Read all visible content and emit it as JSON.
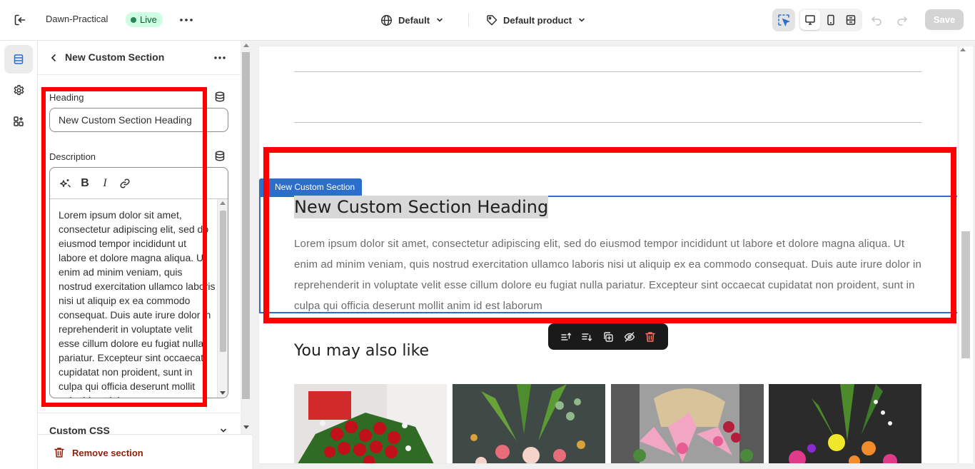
{
  "topbar": {
    "store_name": "Dawn-Practical",
    "status": "Live",
    "theme_select": "Default",
    "template_select": "Default product",
    "save_label": "Save"
  },
  "panel": {
    "title": "New Custom Section",
    "heading_label": "Heading",
    "heading_value": "New Custom Section Heading",
    "description_label": "Description",
    "description_text": "Lorem ipsum dolor sit amet, consectetur adipiscing elit, sed do eiusmod tempor incididunt ut labore et dolore magna aliqua. Ut enim ad minim veniam, quis nostrud exercitation ullamco laboris nisi ut aliquip ex ea commodo consequat. Duis aute irure dolor in reprehenderit in voluptate velit esse cillum dolore eu fugiat nulla pariatur. Excepteur sint occaecat cupidatat non proident, sunt in culpa qui officia deserunt mollit anim id est laborum",
    "rte_tools": [
      "magic-icon",
      "bold-icon",
      "italic-icon",
      "link-icon"
    ],
    "custom_css_label": "Custom CSS",
    "remove_label": "Remove section"
  },
  "preview": {
    "section_tag": "New Custom Section",
    "heading": "New Custom Section Heading",
    "description": "Lorem ipsum dolor sit amet, consectetur adipiscing elit, sed do eiusmod tempor incididunt ut labore et dolore magna aliqua. Ut enim ad minim veniam, quis nostrud exercitation ullamco laboris nisi ut aliquip ex ea commodo consequat. Duis aute irure dolor in reprehenderit in voluptate velit esse cillum dolore eu fugiat nulla pariatur. Excepteur sint occaecat cupidatat non proident, sunt in culpa qui officia deserunt mollit anim id est laborum",
    "also_like": "You may also like",
    "section_tools": [
      "move-up-icon",
      "move-down-icon",
      "duplicate-icon",
      "hide-icon",
      "delete-icon"
    ]
  },
  "colors": {
    "accent": "#2c6ecb",
    "annotation": "#ff0000",
    "live_badge_bg": "#cdfee1",
    "remove_text": "#8e1f0b"
  }
}
